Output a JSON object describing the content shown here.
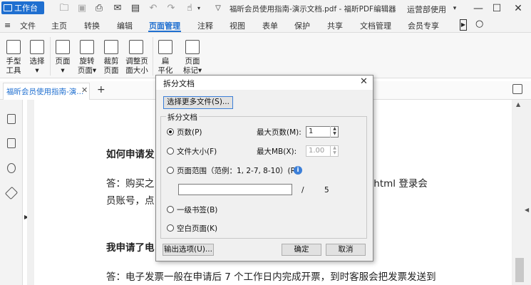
{
  "titlebar": {
    "workbench_label": "工作台",
    "doc_title": "福昕会员使用指南-演示文档.pdf - 福昕PDF编辑器",
    "account": "运营部使用",
    "minimize": "—",
    "maximize": "☐",
    "close": "✕"
  },
  "menubar": {
    "file": "文件",
    "items": [
      "主页",
      "转换",
      "编辑",
      "页面管理",
      "注释",
      "视图",
      "表单",
      "保护",
      "共享",
      "文档管理",
      "会员专享"
    ],
    "active": "页面管理"
  },
  "ribbon": {
    "tools": [
      {
        "label": "手型\n工具"
      },
      {
        "label": "选择"
      },
      {
        "label": "页面"
      },
      {
        "label": "旋转\n页面"
      },
      {
        "label": "裁剪\n页面"
      },
      {
        "label": "调整页\n面大小"
      },
      {
        "label": "扁\n平化"
      },
      {
        "label": "页面\n标记"
      }
    ]
  },
  "tabs": {
    "doc_tab": "福昕会员使用指南-演...",
    "add": "+"
  },
  "page": {
    "line1": "如何申请发",
    "line2a": "答：购买之",
    "line2b": ".html 登录会",
    "line3": "员账号，点",
    "line4": "我申请了电",
    "line5": "答：电子发票一般在申请后 7 个工作日内完成开票，到时客服会把发票发送到"
  },
  "dialog": {
    "title": "拆分文档",
    "close": "✕",
    "more_files_button": "选择更多文件(S)...",
    "group_label": "拆分文档",
    "options": {
      "pages": "页数(P)",
      "file_size": "文件大小(F)",
      "page_range": "页面范围（范例：1, 2-7, 8-10）(R)",
      "bookmarks": "一级书签(B)",
      "blank_page": "空白页面(K)"
    },
    "selected": "页数(P)",
    "max_pages_label": "最大页数(M):",
    "max_pages_value": "1",
    "max_mb_label": "最大MB(X):",
    "max_mb_value": "1.00",
    "range_value": "",
    "range_separator": "/",
    "total_pages": "5",
    "output_button": "输出选项(U)...",
    "ok_button": "确定",
    "cancel_button": "取消"
  }
}
